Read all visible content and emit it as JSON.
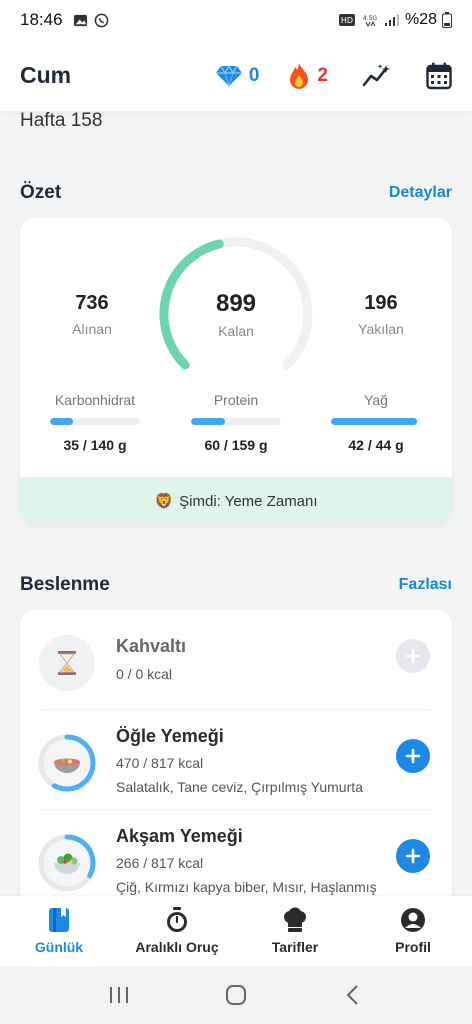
{
  "status_bar": {
    "time": "18:46",
    "battery": "%28"
  },
  "header": {
    "title": "Cum",
    "gems": "0",
    "streak": "2"
  },
  "week_label": "Hafta 158",
  "summary": {
    "section_title": "Özet",
    "details_link": "Detaylar",
    "consumed_value": "736",
    "consumed_label": "Alınan",
    "remaining_value": "899",
    "remaining_label": "Kalan",
    "burned_value": "196",
    "burned_label": "Yakılan",
    "ring_progress": 0.45,
    "macros": [
      {
        "label": "Karbonhidrat",
        "value": "35 / 140 g",
        "progress": 0.25
      },
      {
        "label": "Protein",
        "value": "60 / 159 g",
        "progress": 0.38
      },
      {
        "label": "Yağ",
        "value": "42 / 44 g",
        "progress": 0.95
      }
    ],
    "now_text": "Şimdi: Yeme Zamanı"
  },
  "nutrition": {
    "section_title": "Beslenme",
    "more_link": "Fazlası",
    "meals": [
      {
        "name": "Kahvaltı",
        "kcal": "0 / 0 kcal",
        "desc": "",
        "icon": "hourglass-icon",
        "progress": 0
      },
      {
        "name": "Öğle Yemeği",
        "kcal": "470 / 817 kcal",
        "desc": "Salatalık, Tane ceviz, Çırpılmış Yumurta",
        "icon": "soup-bowl-icon",
        "progress": 0.58
      },
      {
        "name": "Akşam Yemeği",
        "kcal": "266 / 817 kcal",
        "desc": "Çiğ, Kırmızı kapya biber, Mısır, Haşlanmış",
        "icon": "salad-bowl-icon",
        "progress": 0.33
      }
    ]
  },
  "bottom_nav": [
    {
      "label": "Günlük",
      "icon": "diary-icon",
      "active": true
    },
    {
      "label": "Aralıklı Oruç",
      "icon": "stopwatch-icon",
      "active": false
    },
    {
      "label": "Tarifler",
      "icon": "chef-hat-icon",
      "active": false
    },
    {
      "label": "Profil",
      "icon": "profile-icon",
      "active": false
    }
  ],
  "colors": {
    "accent": "#1e88e5",
    "ring": "#6dd3b5",
    "banner": "#dff5ec",
    "link": "#1789d6"
  }
}
